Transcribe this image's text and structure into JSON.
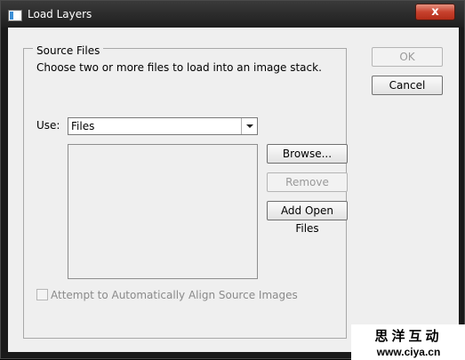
{
  "window": {
    "title": "Load Layers",
    "close_glyph": "x",
    "app_icon": "app-icon"
  },
  "source_files": {
    "legend": "Source Files",
    "description": "Choose two or more files to load into an image stack.",
    "use_label": "Use:",
    "use_value": "Files",
    "file_list": []
  },
  "buttons": {
    "browse": "Browse...",
    "remove": "Remove",
    "add_open_files": "Add Open Files",
    "ok": "OK",
    "cancel": "Cancel"
  },
  "align_option": {
    "label": "Attempt to Automatically Align Source Images",
    "checked": false,
    "enabled": false
  },
  "watermark": {
    "text": "思洋互动",
    "url": "www.ciya.cn"
  }
}
